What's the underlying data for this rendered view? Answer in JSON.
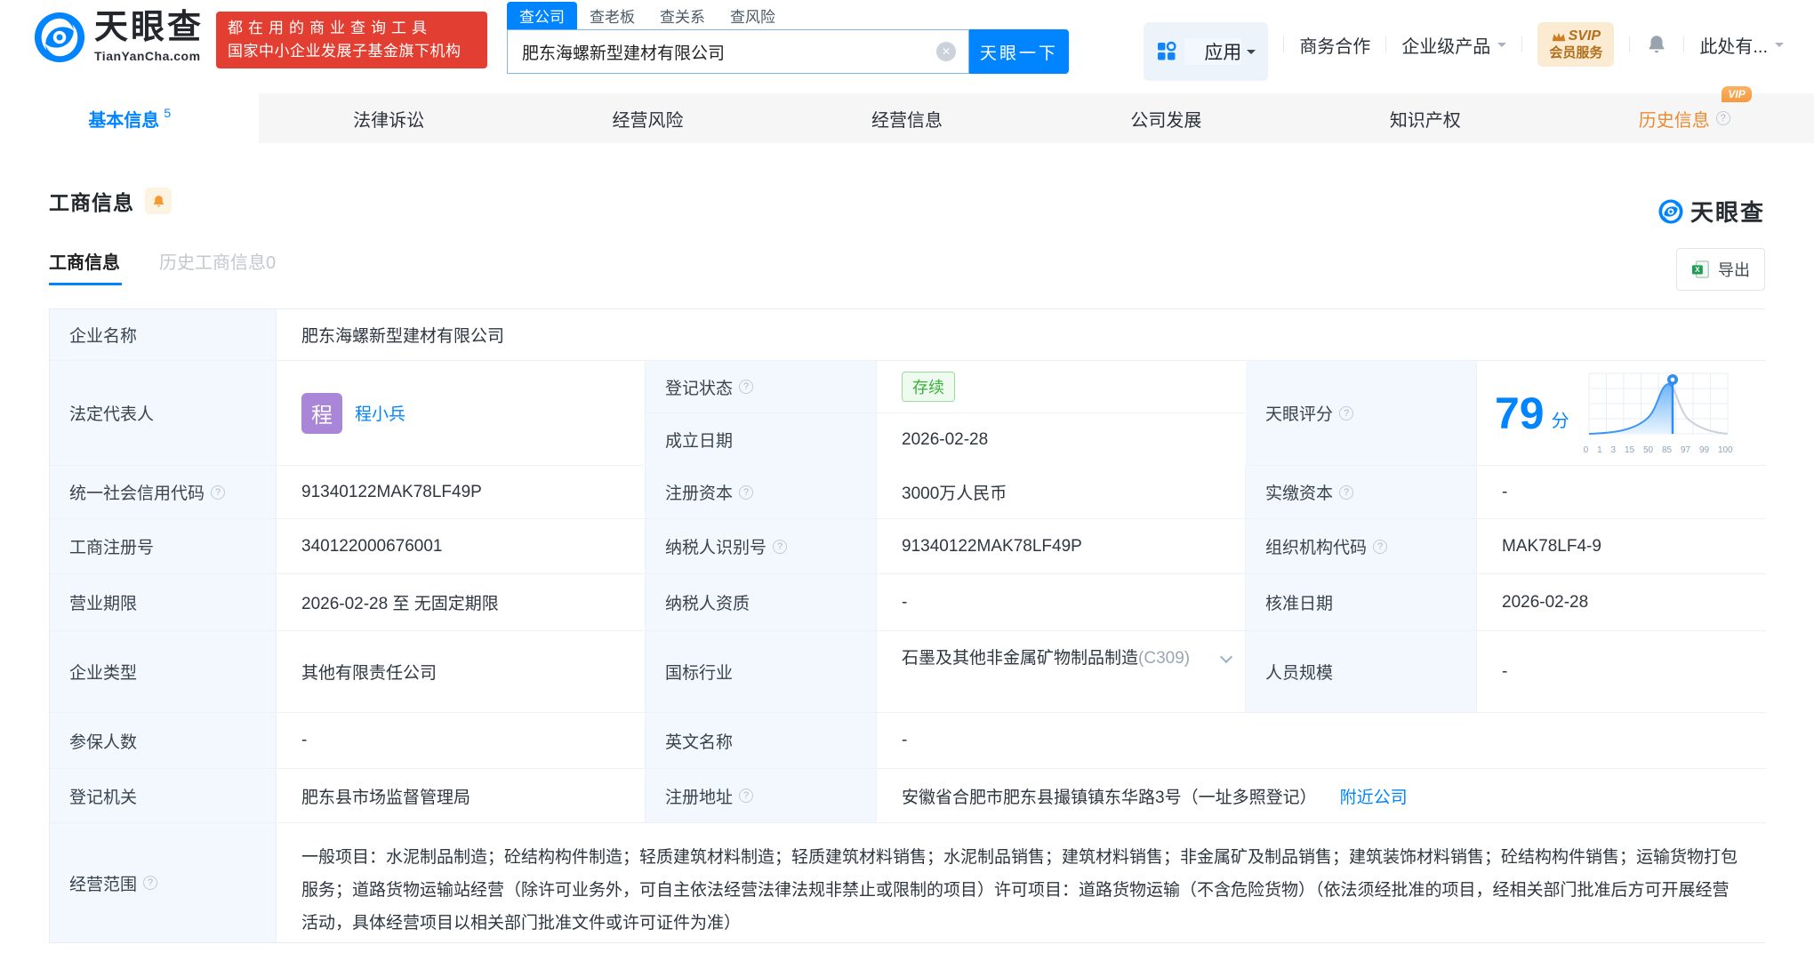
{
  "brand": {
    "name": "天眼查",
    "domain": "TianYanCha.com",
    "slogan_line1": "都在用的商业查询工具",
    "slogan_line2": "国家中小企业发展子基金旗下机构",
    "colors": {
      "primary": "#0084ff",
      "red": "#e23e31",
      "orange": "#ed8a30",
      "label_bg": "#f2f8fd",
      "status_green": "#37b337"
    }
  },
  "search": {
    "tabs": [
      {
        "label": "查公司",
        "active": true
      },
      {
        "label": "查老板",
        "active": false
      },
      {
        "label": "查关系",
        "active": false
      },
      {
        "label": "查风险",
        "active": false
      }
    ],
    "value": "肥东海螺新型建材有限公司",
    "button": "天眼一下"
  },
  "topnav": {
    "apps_label": "应用",
    "items": [
      "商务合作",
      "企业级产品"
    ],
    "svip_line1": "SVIP",
    "svip_line2": "会员服务",
    "user_label": "此处有..."
  },
  "tabs": [
    {
      "label": "基本信息",
      "count": "5"
    },
    {
      "label": "法律诉讼"
    },
    {
      "label": "经营风险"
    },
    {
      "label": "经营信息"
    },
    {
      "label": "公司发展"
    },
    {
      "label": "知识产权"
    },
    {
      "label": "历史信息",
      "vip": "VIP"
    }
  ],
  "section": {
    "title": "工商信息",
    "subtabs": [
      {
        "label": "工商信息"
      },
      {
        "label": "历史工商信息0"
      }
    ],
    "export_label": "导出",
    "watermark": "天眼查"
  },
  "score": {
    "label": "天眼评分",
    "value": "79",
    "unit": "分",
    "ticks": [
      "0",
      "1",
      "3",
      "15",
      "50",
      "85",
      "97",
      "99",
      "100"
    ]
  },
  "chart_data": {
    "type": "area",
    "title": "天眼评分分布曲线",
    "x_ticks": [
      "0",
      "1",
      "3",
      "15",
      "50",
      "85",
      "97",
      "99",
      "100"
    ],
    "marker_value": 79
  },
  "company": {
    "name_label": "企业名称",
    "name": "肥东海螺新型建材有限公司",
    "legal_rep_label": "法定代表人",
    "legal_rep_avatar": "程",
    "legal_rep": "程小兵",
    "reg_status_label": "登记状态",
    "reg_status": "存续",
    "establish_date_label": "成立日期",
    "establish_date": "2026-02-28",
    "credit_code_label": "统一社会信用代码",
    "credit_code": "91340122MAK78LF49P",
    "reg_capital_label": "注册资本",
    "reg_capital": "3000万人民币",
    "paid_capital_label": "实缴资本",
    "paid_capital": "-",
    "reg_number_label": "工商注册号",
    "reg_number": "340122000676001",
    "taxpayer_id_label": "纳税人识别号",
    "taxpayer_id": "91340122MAK78LF49P",
    "org_code_label": "组织机构代码",
    "org_code": "MAK78LF4-9",
    "term_label": "营业期限",
    "term": "2026-02-28 至 无固定期限",
    "taxpayer_quality_label": "纳税人资质",
    "taxpayer_quality": "-",
    "approval_date_label": "核准日期",
    "approval_date": "2026-02-28",
    "type_label": "企业类型",
    "type": "其他有限责任公司",
    "industry_label": "国标行业",
    "industry": "石墨及其他非金属矿物制品制造",
    "industry_code": "(C309)",
    "staff_label": "人员规模",
    "staff": "-",
    "insured_label": "参保人数",
    "insured": "-",
    "english_label": "英文名称",
    "english": "-",
    "authority_label": "登记机关",
    "authority": "肥东县市场监督管理局",
    "address_label": "注册地址",
    "address": "安徽省合肥市肥东县撮镇镇东华路3号（一址多照登记）",
    "nearby_link": "附近公司",
    "scope_label": "经营范围",
    "scope": "一般项目：水泥制品制造；砼结构构件制造；轻质建筑材料制造；轻质建筑材料销售；水泥制品销售；建筑材料销售；非金属矿及制品销售；建筑装饰材料销售；砼结构构件销售；运输货物打包服务；道路货物运输站经营（除许可业务外，可自主依法经营法律法规非禁止或限制的项目）许可项目：道路货物运输（不含危险货物）（依法须经批准的项目，经相关部门批准后方可开展经营活动，具体经营项目以相关部门批准文件或许可证件为准）"
  }
}
